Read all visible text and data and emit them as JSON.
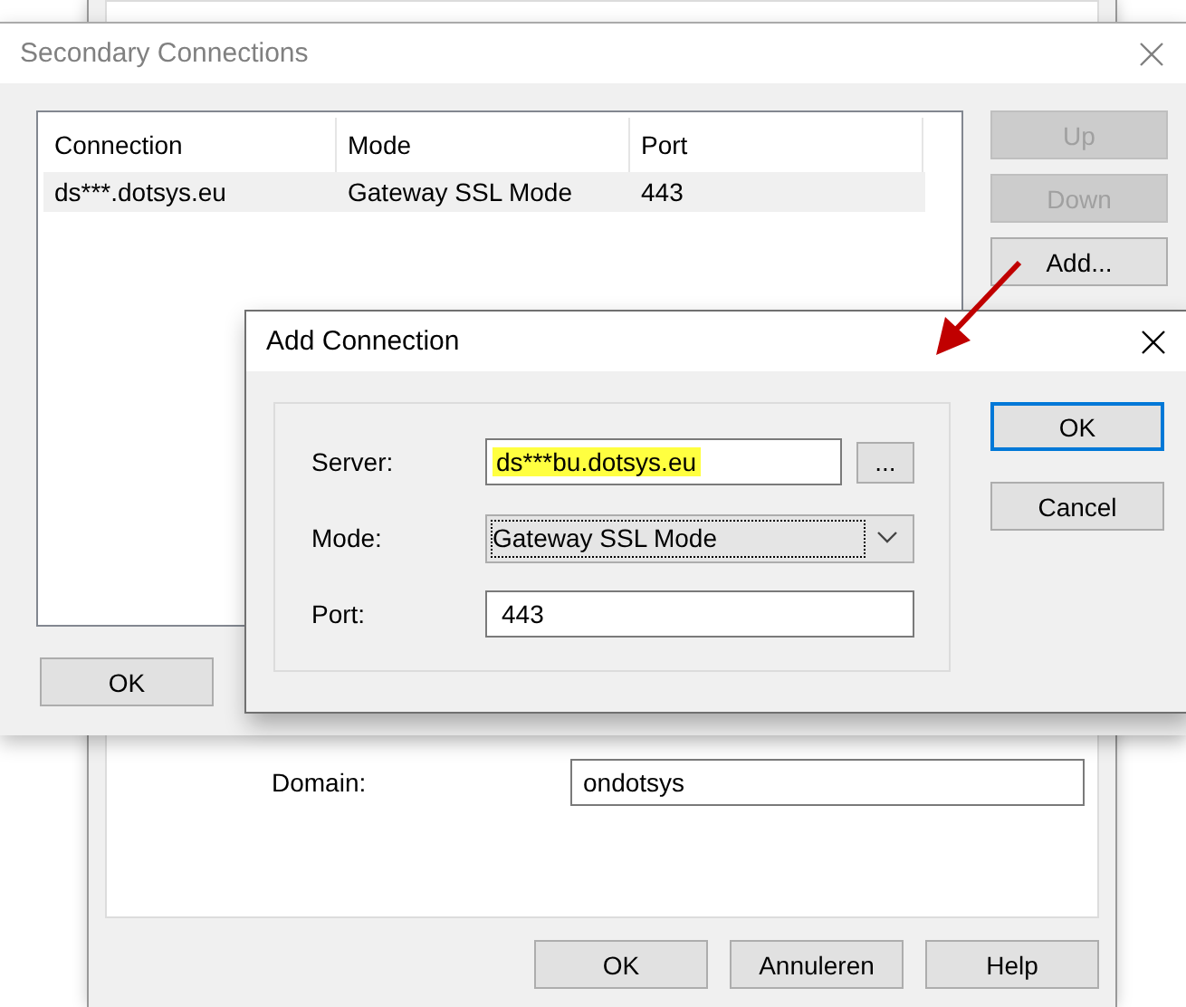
{
  "background_dialog": {
    "domain": {
      "label": "Domain:",
      "value": "ondotsys"
    },
    "buttons": [
      "OK",
      "Annuleren",
      "Help"
    ]
  },
  "secondary_connections": {
    "title": "Secondary Connections",
    "active": false,
    "table": {
      "columns": [
        "Connection",
        "Mode",
        "Port"
      ],
      "rows": [
        {
          "cells": [
            "ds***.dotsys.eu",
            "Gateway SSL Mode",
            "443"
          ],
          "selected": true
        }
      ]
    },
    "side_buttons": [
      {
        "label": "Up",
        "disabled": true
      },
      {
        "label": "Down",
        "disabled": true
      },
      {
        "label": "Add...",
        "disabled": false
      }
    ],
    "buttons": [
      "OK"
    ]
  },
  "add_connection": {
    "title": "Add Connection",
    "active": true,
    "fields": [
      {
        "kind": "text",
        "label": "Server:",
        "value": "ds***bu.dotsys.eu",
        "highlighted": true,
        "browse": "..."
      },
      {
        "kind": "select",
        "label": "Mode:",
        "value": "Gateway SSL Mode",
        "focused": true
      },
      {
        "kind": "text",
        "label": "Port:",
        "value": "443",
        "highlighted": false
      }
    ],
    "buttons": [
      {
        "label": "OK",
        "default": true
      },
      {
        "label": "Cancel",
        "default": false
      }
    ]
  },
  "annotation": {
    "kind": "arrow"
  }
}
